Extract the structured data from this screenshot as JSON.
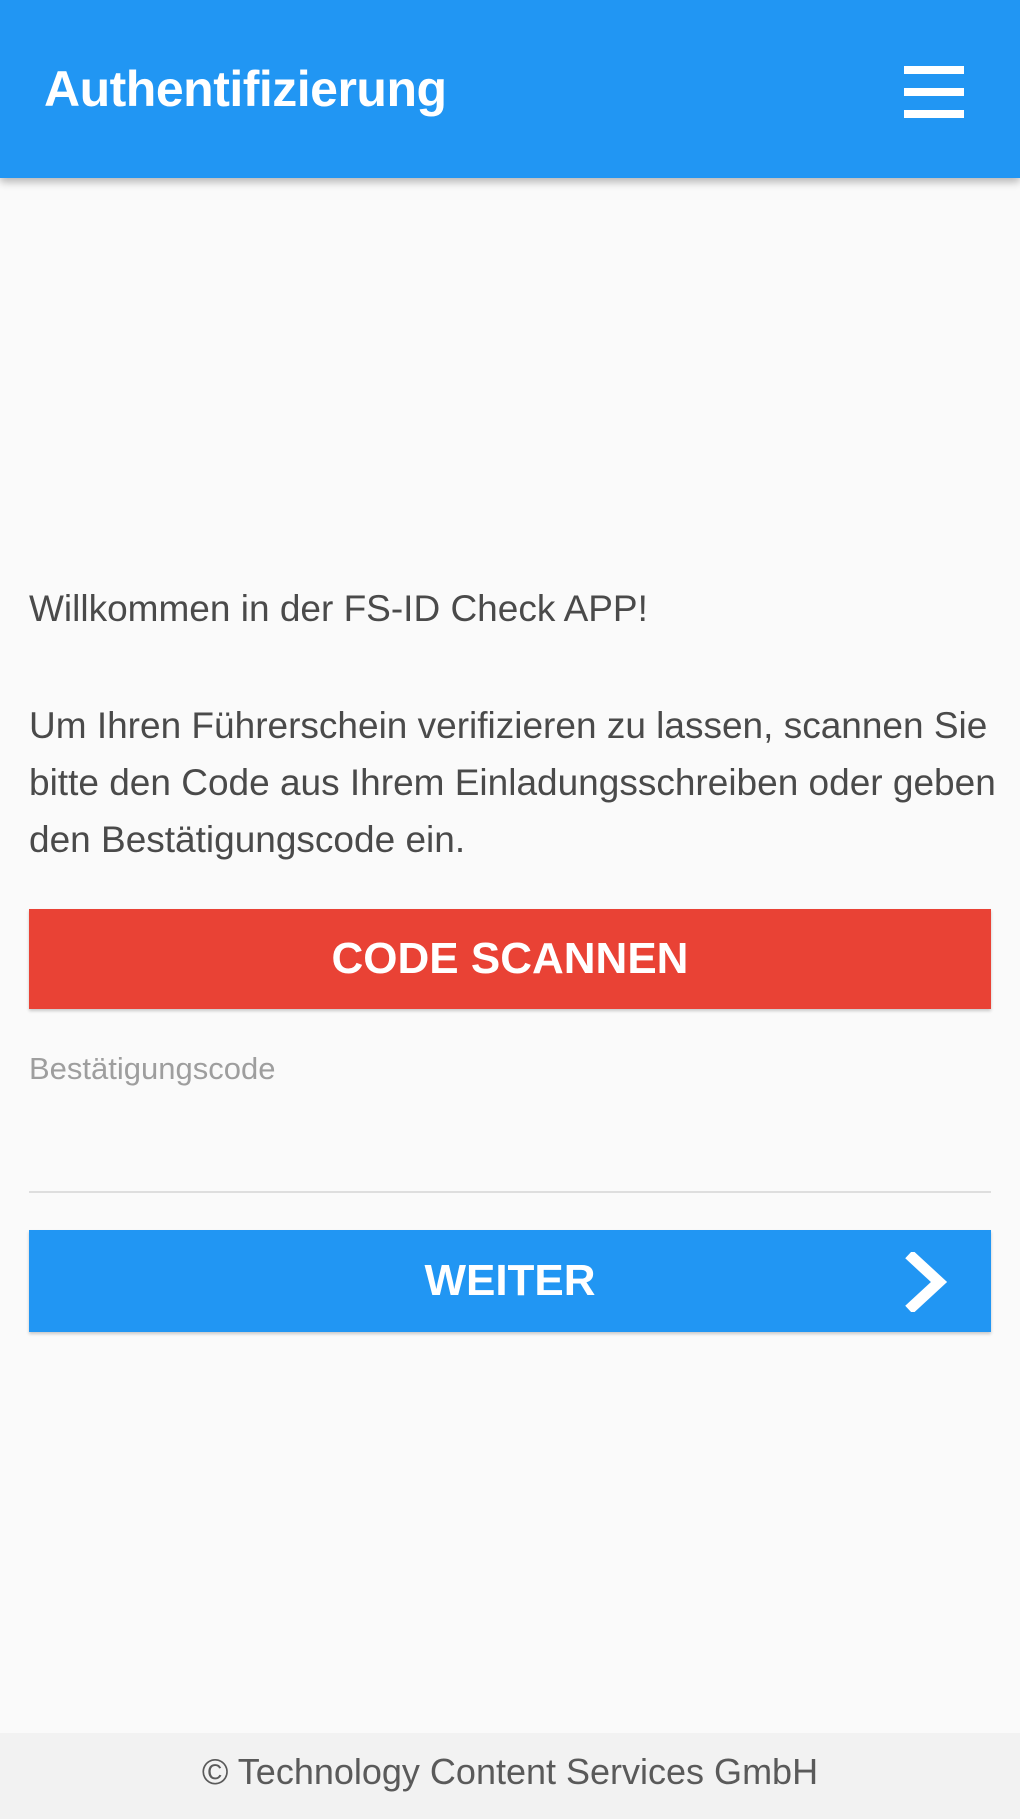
{
  "app_bar": {
    "title": "Authentifizierung",
    "menu_icon": "hamburger-menu-icon",
    "background_color": "#2196f3"
  },
  "content": {
    "welcome": "Willkommen in der FS-ID Check APP!",
    "instructions": "Um Ihren Führerschein verifizieren zu lassen, scannen Sie bitte den Code aus Ihrem Einladungsschreiben oder geben den Bestätigungscode ein.",
    "scan_button_label": "CODE SCANNEN",
    "scan_button_color": "#e94235",
    "code_field": {
      "label": "Bestätigungscode",
      "value": ""
    },
    "next_button_label": "WEITER",
    "next_button_icon": "chevron-right-icon",
    "next_button_color": "#2196f3"
  },
  "footer": {
    "copyright": "© Technology Content Services GmbH"
  }
}
